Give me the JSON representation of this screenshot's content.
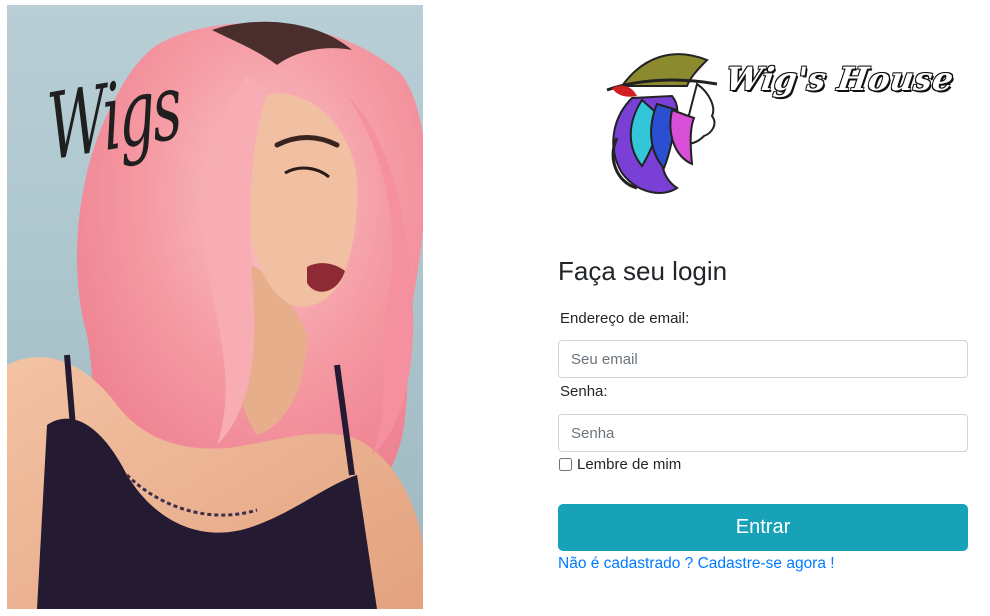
{
  "hero": {
    "script_text": "Wigs",
    "description_icon": "woman-pink-hair-photo"
  },
  "logo": {
    "text": "Wig's House",
    "icon": "woman-profile-hat-logo"
  },
  "form": {
    "title": "Faça seu login",
    "email_label": "Endereço de email:",
    "email_placeholder": "Seu email",
    "email_value": "",
    "password_label": "Senha:",
    "password_placeholder": "Senha",
    "password_value": "",
    "remember_label": "Lembre de mim",
    "remember_checked": false,
    "submit_label": "Entrar",
    "signup_link": "Não é cadastrado ? Cadastre-se agora !"
  },
  "colors": {
    "primary_button": "#17a2b8",
    "link": "#007bff",
    "hair_pink": "#f4a0a8"
  }
}
